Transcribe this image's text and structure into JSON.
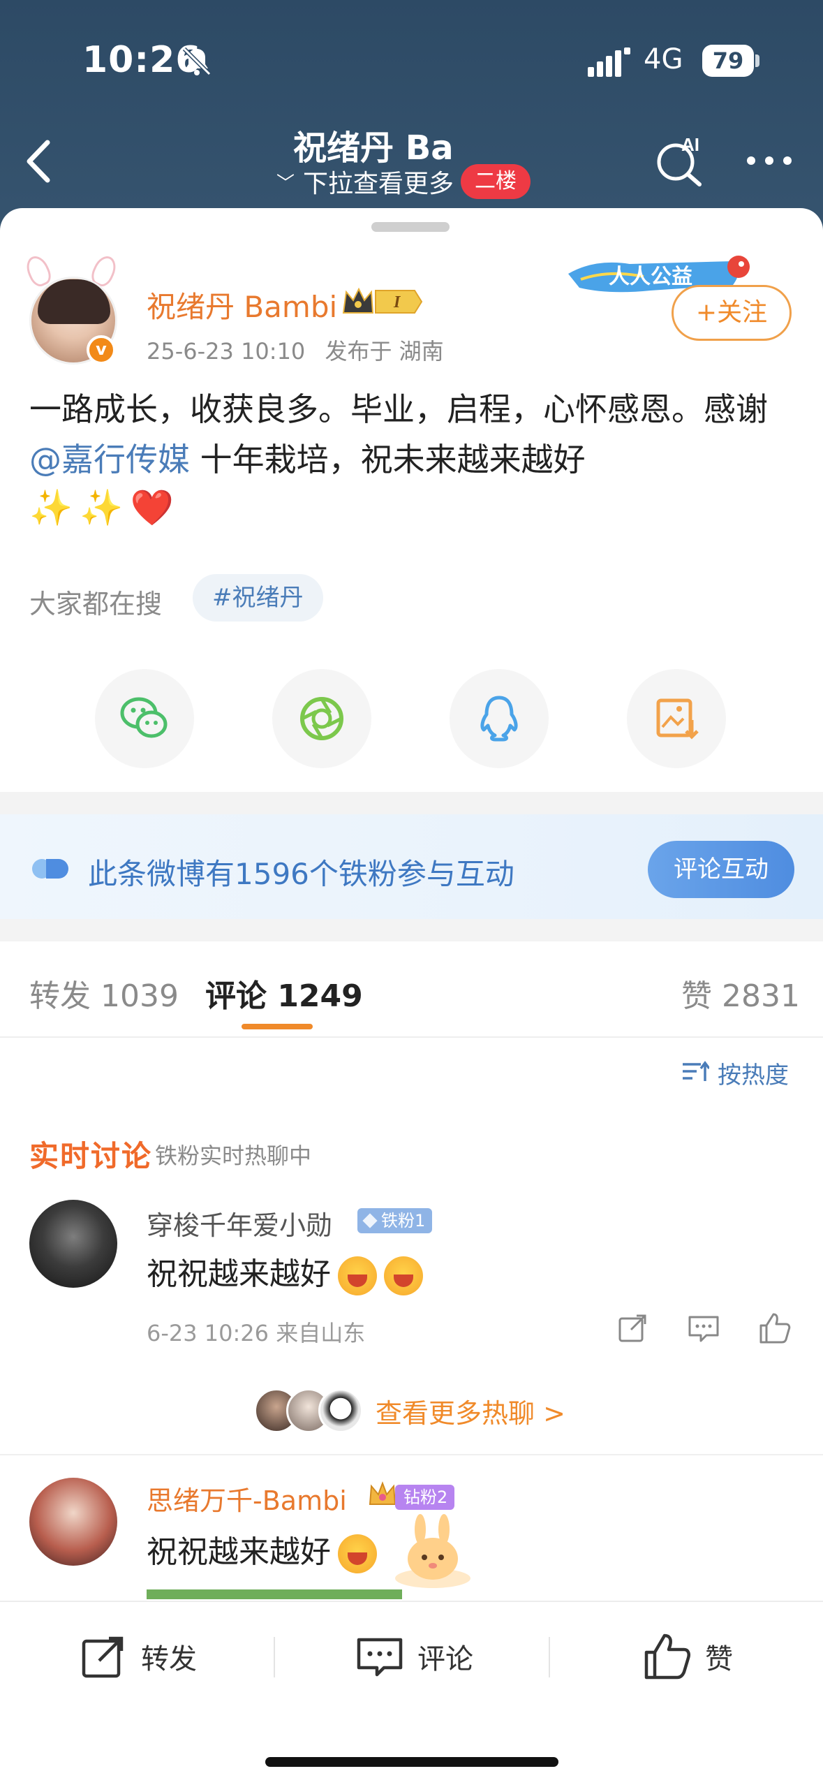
{
  "status_bar": {
    "time": "10:26",
    "network": "4G",
    "battery": "79"
  },
  "nav": {
    "title": "祝绪丹 Ba",
    "subtitle": "下拉查看更多",
    "floor_badge": "二楼"
  },
  "author": {
    "name": "祝绪丹 Bambi",
    "date": "25-6-23 10:10",
    "location": "发布于 湖南",
    "level_badge": "I",
    "charity_badge": "人人公益",
    "follow_label": "+关注"
  },
  "post": {
    "text_before_mention": "一路成长，收获良多。毕业，启程，心怀感恩。感谢 ",
    "mention": "@嘉行传媒",
    "text_after_mention": " 十年栽培，祝未来越来越好",
    "emojis": [
      "✨",
      "✨",
      "❤️"
    ]
  },
  "trending": {
    "label": "大家都在搜",
    "topic": "#祝绪丹"
  },
  "share": [
    "wechat-icon",
    "moments-icon",
    "qq-icon",
    "save-image-icon"
  ],
  "fan_banner": {
    "text": "此条微博有1596个铁粉参与互动",
    "button": "评论互动"
  },
  "tabs": {
    "repost": "转发 1039",
    "comment": "评论 1249",
    "like": "赞 2831"
  },
  "sort": {
    "label": "按热度"
  },
  "live": {
    "title": "实时讨论",
    "subtitle": "铁粉实时热聊中"
  },
  "comments": [
    {
      "user": "穿梭千年爱小勋",
      "badge": "铁粉1",
      "text": "祝祝越来越好",
      "meta": "6-23 10:26 来自山东"
    },
    {
      "user": "思绪万千-Bambi",
      "badge": "钻粉2",
      "text": "祝祝越来越好"
    }
  ],
  "more_hot": {
    "label": "查看更多热聊 >"
  },
  "bottom_bar": {
    "repost": "转发",
    "comment": "评论",
    "like": "赞"
  },
  "colors": {
    "header_bg": "#2d4a65",
    "accent_orange": "#f08a2a",
    "link_blue": "#4a7cb8",
    "badge_red": "#ee3a44"
  }
}
